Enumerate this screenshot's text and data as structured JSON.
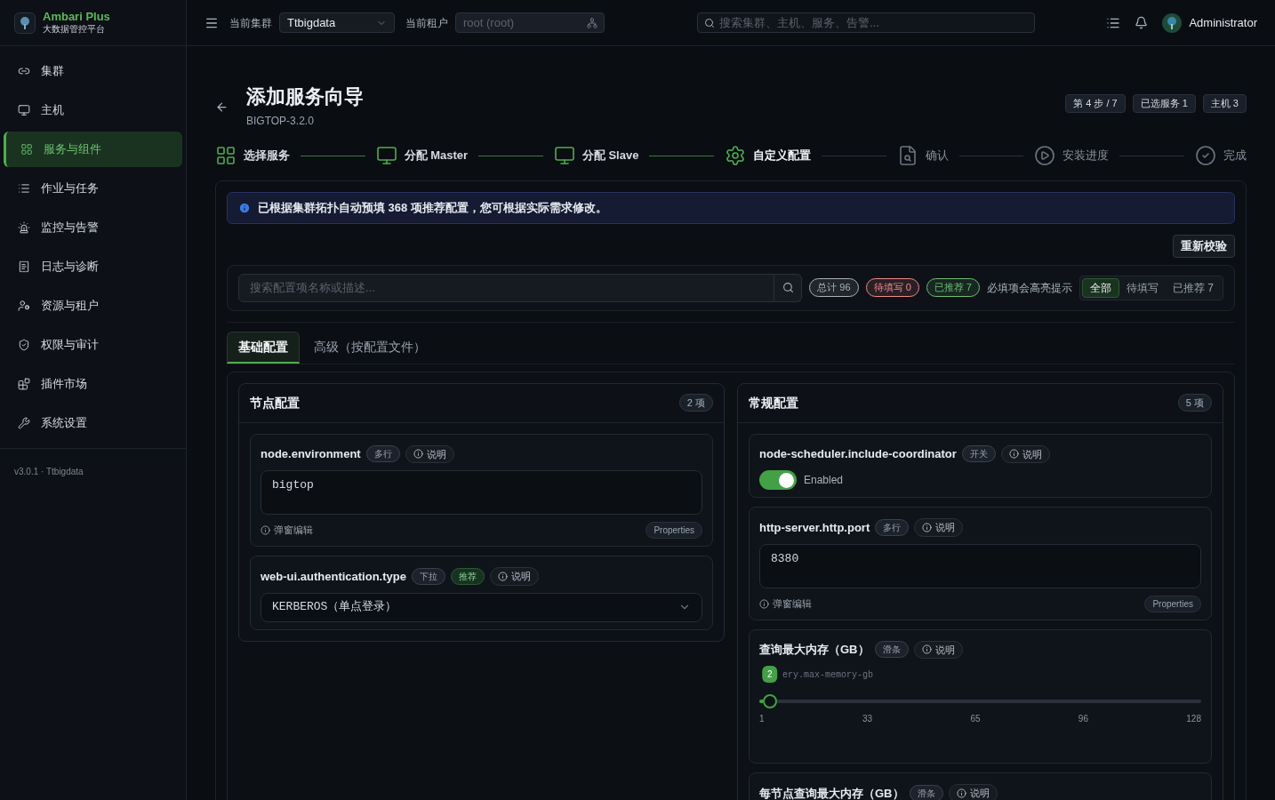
{
  "brand": {
    "name": "Ambari Plus",
    "subtitle": "大数据管控平台"
  },
  "sidebar": {
    "items": [
      {
        "label": "集群",
        "selected": false
      },
      {
        "label": "主机",
        "selected": false
      },
      {
        "label": "服务与组件",
        "selected": true
      },
      {
        "label": "作业与任务",
        "selected": false
      },
      {
        "label": "监控与告警",
        "selected": false
      },
      {
        "label": "日志与诊断",
        "selected": false
      },
      {
        "label": "资源与租户",
        "selected": false
      },
      {
        "label": "权限与审计",
        "selected": false
      },
      {
        "label": "插件市场",
        "selected": false
      },
      {
        "label": "系统设置",
        "selected": false
      }
    ],
    "version": "v3.0.1 · Ttbigdata"
  },
  "topbar": {
    "cluster_label": "当前集群",
    "cluster_value": "Ttbigdata",
    "tenant_label": "当前租户",
    "tenant_placeholder": "root (root)",
    "search_placeholder": "搜索集群、主机、服务、告警...",
    "user": "Administrator"
  },
  "page": {
    "title": "添加服务向导",
    "subtitle": "BIGTOP-3.2.0",
    "badges": [
      "第 4 步 / 7",
      "已选服务 1",
      "主机 3"
    ]
  },
  "steps": [
    {
      "label": "选择服务",
      "completed": true,
      "selected": false
    },
    {
      "label": "分配 Master",
      "completed": true,
      "selected": false
    },
    {
      "label": "分配 Slave",
      "completed": true,
      "selected": false
    },
    {
      "label": "自定义配置",
      "completed": false,
      "selected": true
    },
    {
      "label": "确认",
      "completed": false,
      "selected": false
    },
    {
      "label": "安装进度",
      "completed": false,
      "selected": false
    },
    {
      "label": "完成",
      "completed": false,
      "selected": false
    }
  ],
  "alert": {
    "text": "已根据集群拓扑自动预填 368 项推荐配置，您可根据实际需求修改。"
  },
  "revalidate_button": "重新校验",
  "filter": {
    "placeholder": "搜索配置项名称或描述...",
    "counts": [
      {
        "label": "总计 96",
        "color": "#aab2bc"
      },
      {
        "label": "待填写 0",
        "color": "#f08a8a"
      },
      {
        "label": "已推荐 7",
        "color": "#6cc070"
      }
    ],
    "hint": "必填项会高亮提示",
    "segments": [
      {
        "label": "全部",
        "selected": true
      },
      {
        "label": "待填写",
        "selected": false
      },
      {
        "label": "已推荐 7",
        "selected": false
      }
    ]
  },
  "tabs": [
    {
      "label": "基础配置",
      "selected": true
    },
    {
      "label": "高级（按配置文件）",
      "selected": false
    }
  ],
  "groups": [
    {
      "title": "节点配置",
      "count": "2 项",
      "items": [
        {
          "kind": "textarea",
          "name": "node.environment",
          "type_tag": "多行",
          "help": "说明",
          "value": "bigtop",
          "popup_edit": "弹窗编辑",
          "format": "Properties"
        },
        {
          "kind": "select",
          "name": "web-ui.authentication.type",
          "type_tag": "下拉",
          "recommended_tag": "推荐",
          "help": "说明",
          "value": "KERBEROS（单点登录）"
        }
      ]
    },
    {
      "title": "常规配置",
      "count": "5 项",
      "items": [
        {
          "kind": "switch",
          "name": "node-scheduler.include-coordinator",
          "type_tag": "开关",
          "help": "说明",
          "on": true,
          "state_label": "Enabled"
        },
        {
          "kind": "textarea",
          "name": "http-server.http.port",
          "type_tag": "多行",
          "help": "说明",
          "value": "8380",
          "popup_edit": "弹窗编辑",
          "format": "Properties"
        },
        {
          "kind": "slider",
          "name": "查询最大内存（GB）",
          "type_tag": "滑条",
          "help": "说明",
          "key": "ery.max-memory-gb",
          "bubble": "2",
          "level": 0.008,
          "ticks": [
            "1",
            "33",
            "65",
            "96",
            "128"
          ]
        },
        {
          "kind": "slider",
          "name": "每节点查询最大内存（GB）",
          "type_tag": "滑条",
          "help": "说明"
        }
      ]
    }
  ]
}
